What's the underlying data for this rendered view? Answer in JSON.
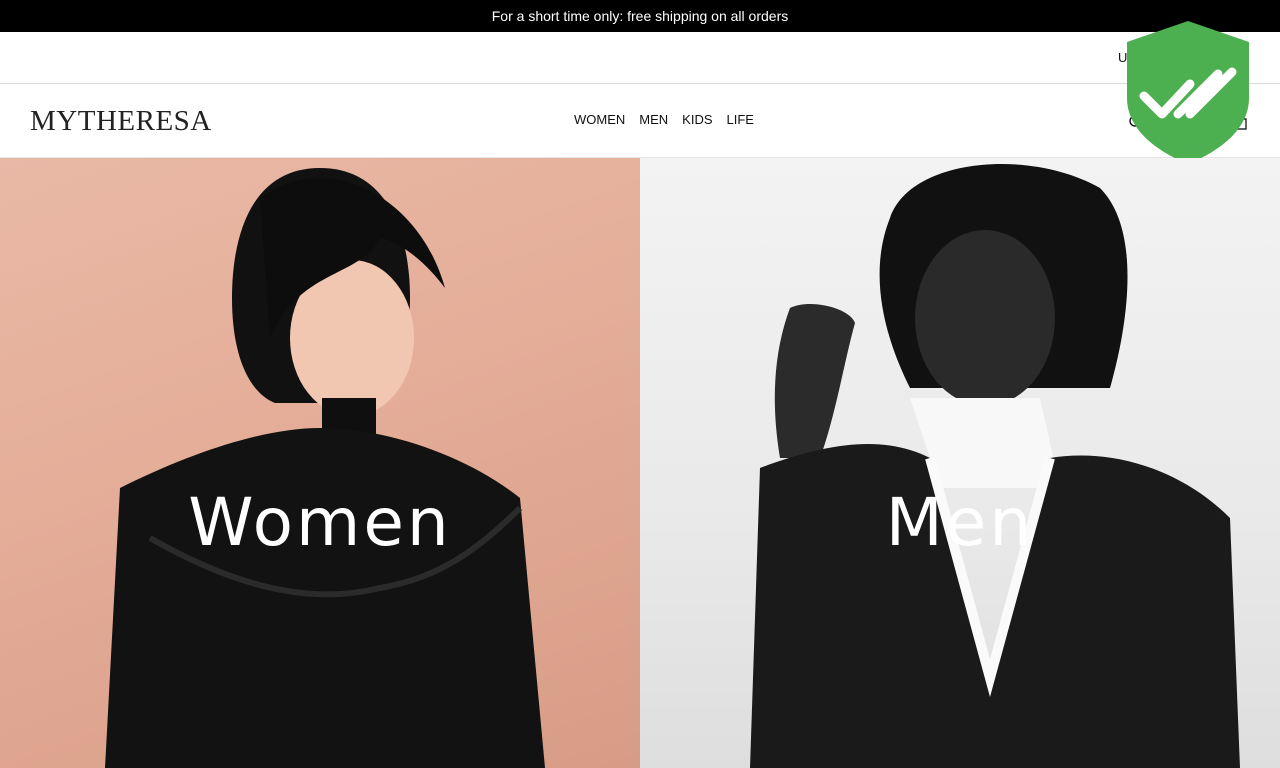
{
  "promo": {
    "text": "For a short time only: free shipping on all orders"
  },
  "utility": {
    "text": "U"
  },
  "header": {
    "logo": "MYTHERESA",
    "nav": [
      {
        "label": "WOMEN"
      },
      {
        "label": "MEN"
      },
      {
        "label": "KIDS"
      },
      {
        "label": "LIFE"
      }
    ]
  },
  "icons": {
    "search": "search-icon",
    "bag": "shopping-bag-icon",
    "badge": "security-shield-check-icon"
  },
  "hero": {
    "women": {
      "label": "Women"
    },
    "men": {
      "label": "Men"
    }
  },
  "colors": {
    "promo_bg": "#000000",
    "badge_green": "#4caf50",
    "women_bg": "#e4ad98",
    "men_bg": "#ececec"
  }
}
